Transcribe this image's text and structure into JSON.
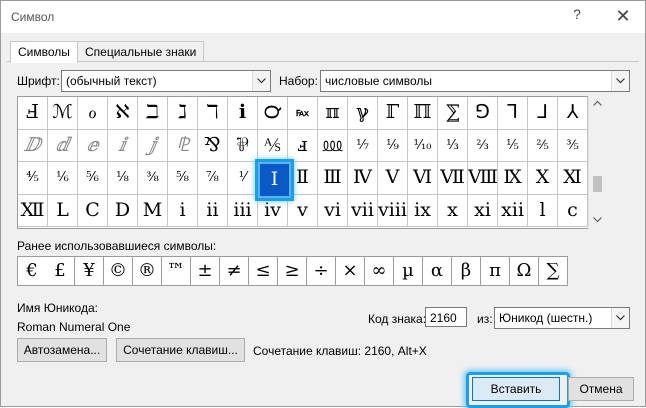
{
  "window": {
    "title": "Символ",
    "help_glyph": "?",
    "close_glyph": "✕"
  },
  "tabs": [
    "Символы",
    "Специальные знаки"
  ],
  "font": {
    "label": "Шрифт:",
    "value": "(обычный текст)"
  },
  "subset": {
    "label": "Набор:",
    "value": "числовые символы"
  },
  "grid": [
    [
      "Ⅎ",
      "ℳ",
      "ℴ",
      "ℵ",
      "ℶ",
      "ℷ",
      "ℸ",
      "ℹ",
      "℺",
      "℻",
      "ℼ",
      "ℽ",
      "ℾ",
      "ℿ",
      "⅀",
      "⅁",
      "⅂",
      "⅃",
      "⅄"
    ],
    [
      "ⅅ",
      "ⅆ",
      "ⅇ",
      "ⅈ",
      "ⅉ",
      "⅊",
      "⅋",
      "⅌",
      "⅍",
      "ⅎ",
      "⅏",
      "⅐",
      "⅑",
      "⅒",
      "⅓",
      "⅔",
      "⅕",
      "⅖",
      "⅗"
    ],
    [
      "⅘",
      "⅙",
      "⅚",
      "⅛",
      "⅜",
      "⅝",
      "⅞",
      "⅟",
      "Ⅰ",
      "Ⅱ",
      "Ⅲ",
      "Ⅳ",
      "Ⅴ",
      "Ⅵ",
      "Ⅶ",
      "Ⅷ",
      "Ⅸ",
      "Ⅹ",
      "Ⅺ"
    ],
    [
      "Ⅻ",
      "Ⅼ",
      "Ⅽ",
      "Ⅾ",
      "Ⅿ",
      "ⅰ",
      "ⅱ",
      "ⅲ",
      "ⅳ",
      "ⅴ",
      "ⅵ",
      "ⅶ",
      "ⅷ",
      "ⅸ",
      "ⅹ",
      "ⅺ",
      "ⅻ",
      "ⅼ",
      "ⅽ"
    ]
  ],
  "selected_cell": "Ⅰ",
  "recent": {
    "label": "Ранее использовавшиеся символы:",
    "symbols": [
      "€",
      "£",
      "¥",
      "©",
      "®",
      "™",
      "±",
      "≠",
      "≤",
      "≥",
      "÷",
      "×",
      "∞",
      "µ",
      "α",
      "β",
      "π",
      "Ω",
      "∑"
    ]
  },
  "unicode_name": {
    "label": "Имя Юникода:",
    "value": "Roman Numeral One"
  },
  "char_code": {
    "label": "Код знака:",
    "value": "2160"
  },
  "from": {
    "label": "из:",
    "value": "Юникод (шестн.)"
  },
  "buttons": {
    "autocorrect": "Автозамена...",
    "shortcut_key": "Сочетание клавиш...",
    "insert": "Вставить",
    "cancel": "Отмена"
  },
  "shortcut_text": "Сочетание клавиш: 2160, Alt+X"
}
